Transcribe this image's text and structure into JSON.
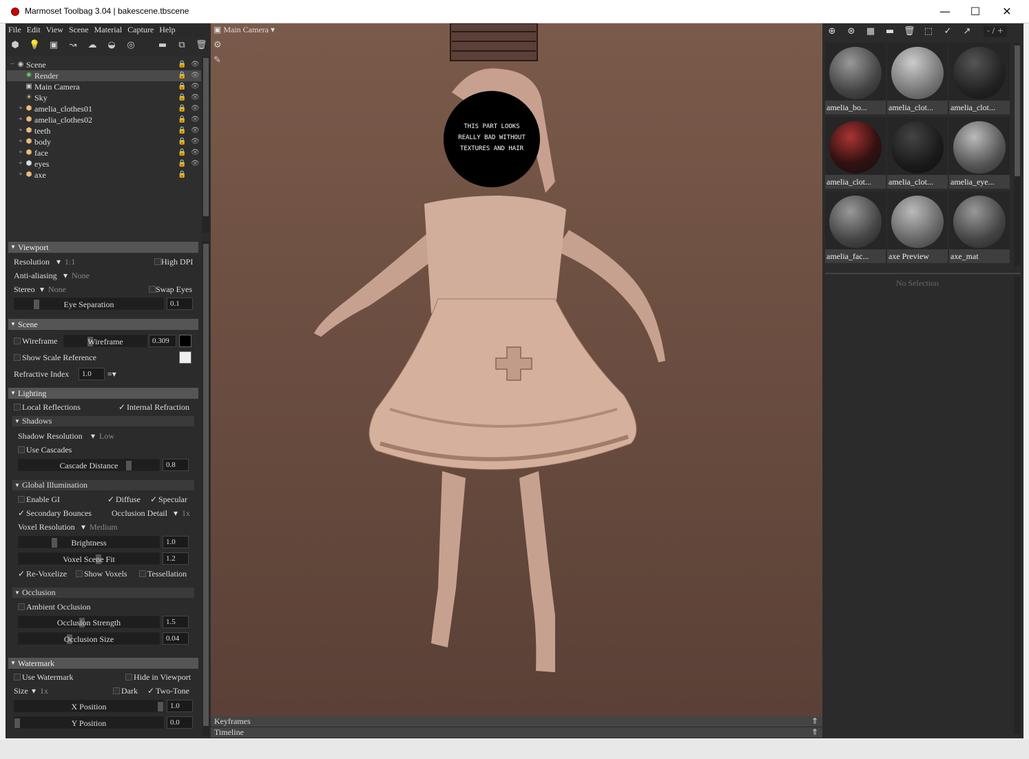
{
  "window": {
    "title": "Marmoset Toolbag 3.04  |  bakescene.tbscene",
    "minimize": "—",
    "maximize": "☐",
    "close": "✕"
  },
  "menu": [
    "File",
    "Edit",
    "View",
    "Scene",
    "Material",
    "Capture",
    "Help"
  ],
  "scene_tree": [
    {
      "label": "Scene",
      "icon": "scene-icon",
      "selected": false
    },
    {
      "label": "Render",
      "icon": "render-icon",
      "selected": true
    },
    {
      "label": "Main Camera",
      "icon": "camera-icon",
      "selected": false
    },
    {
      "label": "Sky",
      "icon": "sky-icon",
      "selected": false
    },
    {
      "label": "amelia_clothes01",
      "icon": "mesh-icon",
      "selected": false
    },
    {
      "label": "amelia_clothes02",
      "icon": "mesh-icon",
      "selected": false
    },
    {
      "label": "teeth",
      "icon": "mesh-icon",
      "selected": false
    },
    {
      "label": "body",
      "icon": "mesh-icon",
      "selected": false
    },
    {
      "label": "face",
      "icon": "mesh-icon",
      "selected": false
    },
    {
      "label": "eyes",
      "icon": "mesh-icon",
      "selected": false
    },
    {
      "label": "axe",
      "icon": "mesh-icon",
      "selected": false
    }
  ],
  "props": {
    "viewport": {
      "title": "Viewport",
      "resolution_label": "Resolution",
      "resolution_value": "1:1",
      "high_dpi": "High DPI",
      "antialiasing_label": "Anti-aliasing",
      "antialiasing_value": "None",
      "stereo_label": "Stereo",
      "stereo_value": "None",
      "swap_eyes": "Swap Eyes",
      "eye_sep_label": "Eye Separation",
      "eye_sep_value": "0.1"
    },
    "scene": {
      "title": "Scene",
      "wireframe": "Wireframe",
      "wireframe_slider": "Wireframe",
      "wireframe_value": "0.309",
      "show_scale": "Show Scale Reference",
      "refr_label": "Refractive Index",
      "refr_value": "1.0",
      "refr_menu": "≡▾"
    },
    "lighting": {
      "title": "Lighting",
      "local_refl": "Local Reflections",
      "internal_refr": "Internal Refraction",
      "shadows": "Shadows",
      "shadow_res_label": "Shadow Resolution",
      "shadow_res_value": "Low",
      "use_cascades": "Use Cascades",
      "cascade_label": "Cascade Distance",
      "cascade_value": "0.8",
      "gi": "Global Illumination",
      "enable_gi": "Enable GI",
      "diffuse": "Diffuse",
      "specular": "Specular",
      "secondary": "Secondary Bounces",
      "occl_detail_label": "Occlusion Detail",
      "occl_detail_value": "1x",
      "voxel_res_label": "Voxel Resolution",
      "voxel_res_value": "Medium",
      "brightness_label": "Brightness",
      "brightness_value": "1.0",
      "voxel_fit_label": "Voxel Scene Fit",
      "voxel_fit_value": "1.2",
      "revoxelize": "Re-Voxelize",
      "show_voxels": "Show Voxels",
      "tessellation": "Tessellation",
      "occlusion": "Occlusion",
      "ambient_occ": "Ambient Occlusion",
      "occ_strength_label": "Occlusion Strength",
      "occ_strength_value": "1.5",
      "occ_size_label": "Occlusion Size",
      "occ_size_value": "0.04"
    },
    "watermark": {
      "title": "Watermark",
      "use_wm": "Use Watermark",
      "hide_vp": "Hide in Viewport",
      "size_label": "Size",
      "size_value": "1x",
      "dark": "Dark",
      "two_tone": "Two-Tone",
      "xpos_label": "X Position",
      "xpos_value": "1.0",
      "ypos_label": "Y Position",
      "ypos_value": "0.0"
    }
  },
  "viewport": {
    "camera": "Main Camera",
    "annotation": [
      "THIS PART LOOKS",
      "REALLY BAD WITHOUT",
      "TEXTURES AND HAIR"
    ]
  },
  "timeline": {
    "keyframes": "Keyframes",
    "timeline": "Timeline"
  },
  "materials_counter": "- / +",
  "materials": [
    {
      "label": "amelia_bo...",
      "style": "plain"
    },
    {
      "label": "amelia_clot...",
      "style": "textured"
    },
    {
      "label": "amelia_clot...",
      "style": "dark"
    },
    {
      "label": "amelia_clot...",
      "style": "red"
    },
    {
      "label": "amelia_clot...",
      "style": "dark"
    },
    {
      "label": "amelia_eye...",
      "style": "plain"
    },
    {
      "label": "amelia_fac...",
      "style": "plain"
    },
    {
      "label": "axe Preview",
      "style": "textured"
    },
    {
      "label": "axe_mat",
      "style": "plain"
    }
  ],
  "no_selection": "No Selection"
}
